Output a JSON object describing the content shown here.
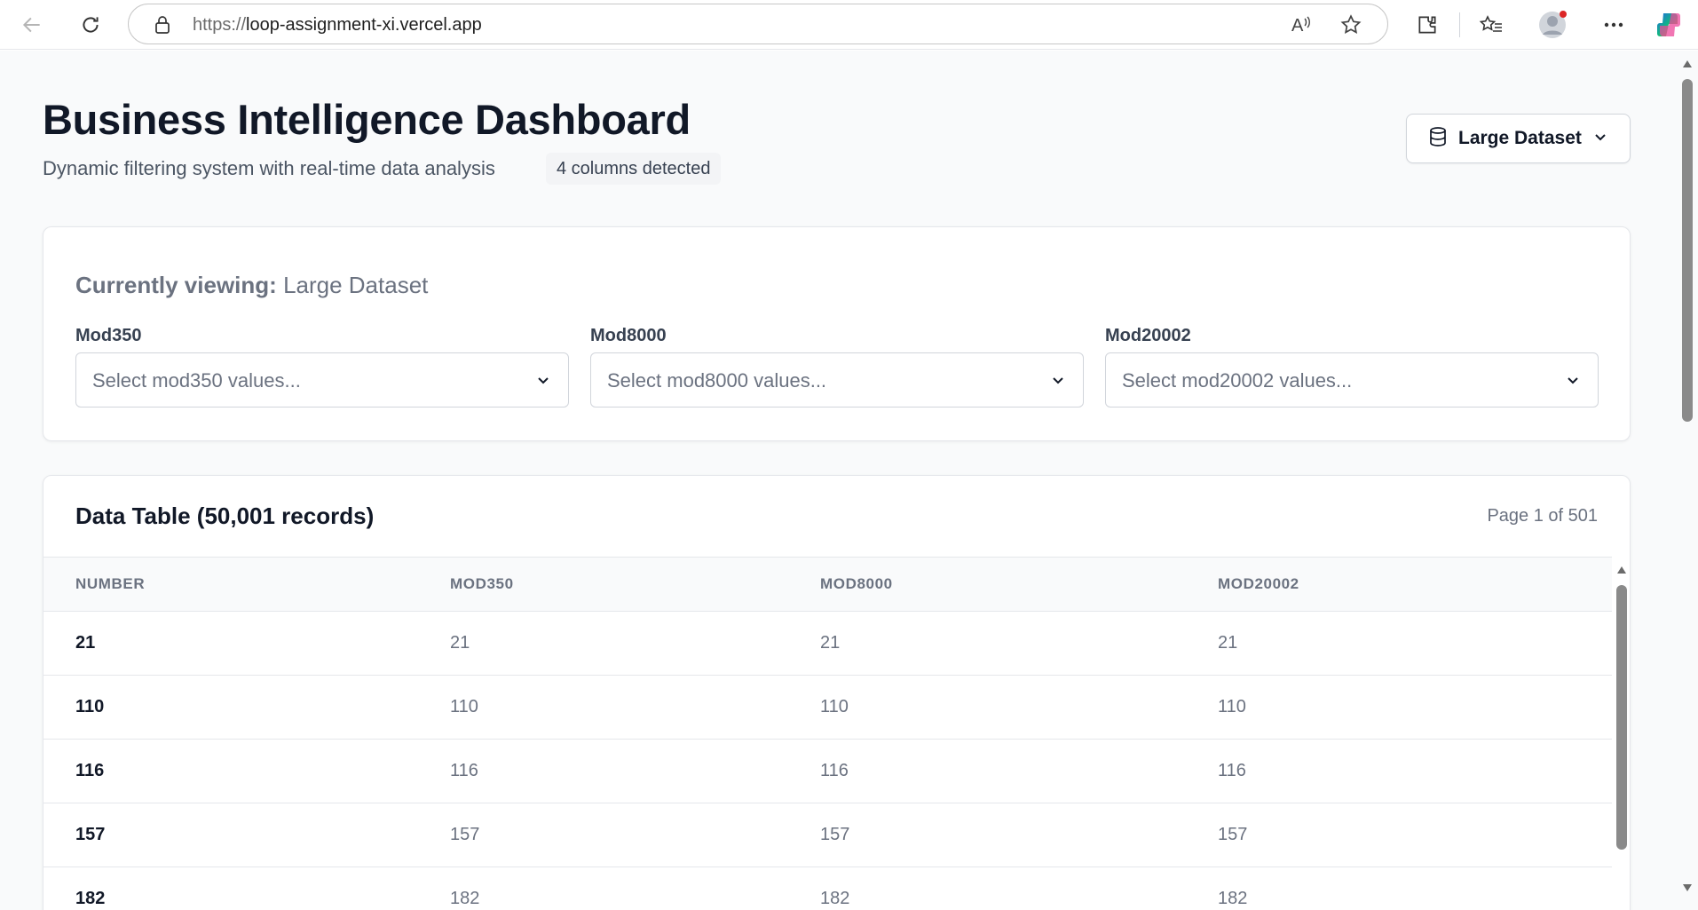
{
  "browser": {
    "url_scheme": "https://",
    "url_host": "loop-assignment-xi.vercel.app",
    "icons": [
      "back-arrow-icon",
      "refresh-icon",
      "lock-icon",
      "read-aloud-icon",
      "favorite-star-icon",
      "extensions-icon",
      "favorites-icon",
      "profile-icon",
      "more-icon",
      "copilot-icon"
    ]
  },
  "header": {
    "title": "Business Intelligence Dashboard",
    "subtitle": "Dynamic filtering system with real-time data analysis",
    "badge": "4 columns detected",
    "dataset_button": "Large Dataset"
  },
  "filters": {
    "viewing_label": "Currently viewing:",
    "viewing_value": "Large Dataset",
    "items": [
      {
        "label": "Mod350",
        "placeholder": "Select mod350 values..."
      },
      {
        "label": "Mod8000",
        "placeholder": "Select mod8000 values..."
      },
      {
        "label": "Mod20002",
        "placeholder": "Select mod20002 values..."
      }
    ]
  },
  "table": {
    "title": "Data Table (50,001 records)",
    "page_info": "Page 1 of 501",
    "columns": [
      "NUMBER",
      "MOD350",
      "MOD8000",
      "MOD20002"
    ],
    "rows": [
      [
        "21",
        "21",
        "21",
        "21"
      ],
      [
        "110",
        "110",
        "110",
        "110"
      ],
      [
        "116",
        "116",
        "116",
        "116"
      ],
      [
        "157",
        "157",
        "157",
        "157"
      ],
      [
        "182",
        "182",
        "182",
        "182"
      ]
    ]
  },
  "colors": {
    "page_bg": "#f9fafb",
    "text_primary": "#111827",
    "text_muted": "#6b7280",
    "border": "#e5e7eb"
  }
}
